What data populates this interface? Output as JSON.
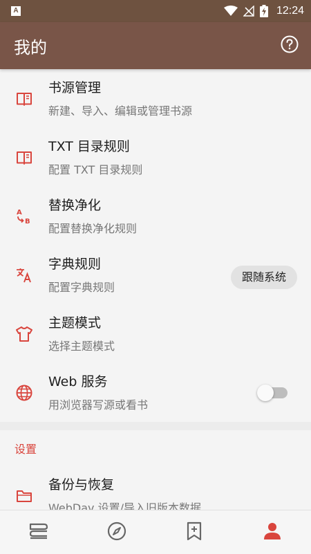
{
  "status": {
    "time": "12:24",
    "app_icon_letter": "A"
  },
  "app_bar": {
    "title": "我的",
    "help_icon": "help-circle-icon"
  },
  "items": [
    {
      "title": "书源管理",
      "subtitle": "新建、导入、编辑或管理书源",
      "icon": "book-open-icon"
    },
    {
      "title": "TXT 目录规则",
      "subtitle": "配置 TXT 目录规则",
      "icon": "book-open-icon"
    },
    {
      "title": "替换净化",
      "subtitle": "配置替换净化规则",
      "icon": "replace-ab-icon"
    },
    {
      "title": "字典规则",
      "subtitle": "配置字典规则",
      "icon": "translate-icon"
    },
    {
      "title": "主题模式",
      "subtitle": "选择主题模式",
      "icon": "tshirt-icon",
      "value": "跟随系统"
    },
    {
      "title": "Web 服务",
      "subtitle": "用浏览器写源或看书",
      "icon": "globe-icon",
      "toggle": false
    }
  ],
  "settings": {
    "header": "设置",
    "items": [
      {
        "title": "备份与恢复",
        "subtitle": "WebDav 设置/导入旧版本数据",
        "icon": "folder-icon"
      }
    ]
  },
  "bottom_nav": [
    {
      "name": "bookshelf",
      "icon": "bookshelf-icon"
    },
    {
      "name": "discover",
      "icon": "compass-icon"
    },
    {
      "name": "rss",
      "icon": "bookmark-add-icon"
    },
    {
      "name": "my",
      "icon": "person-icon",
      "active": true
    }
  ],
  "colors": {
    "primary": "#795548",
    "status_bar": "#6e5240",
    "accent": "#d9453d",
    "background": "#f4f4f4"
  }
}
